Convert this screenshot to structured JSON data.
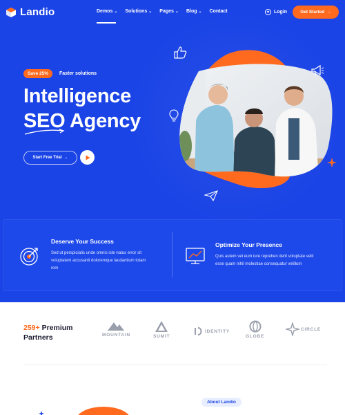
{
  "brand": {
    "name": "Landio"
  },
  "nav": {
    "items": [
      {
        "label": "Demos",
        "dropdown": true
      },
      {
        "label": "Solutions",
        "dropdown": true
      },
      {
        "label": "Pages",
        "dropdown": true
      },
      {
        "label": "Blog",
        "dropdown": true
      },
      {
        "label": "Contact",
        "dropdown": false
      }
    ],
    "login_label": "Login",
    "cta_label": "Get Started"
  },
  "hero": {
    "badge": "Save 25%",
    "badge_text": "Faster solutions",
    "headline_line1": "Intelligence",
    "headline_line2": "SEO Agency",
    "trial_label": "Start Free Trial"
  },
  "features": [
    {
      "title": "Deserve Your Success",
      "body_line1": "Sed ut perspiciatis unde omnis iste natus error sit",
      "body_line2": "voluptatem accusanti doloremque laudantium totam",
      "body_line3": "rem",
      "icon": "target-icon"
    },
    {
      "title": "Optimize Your Presence",
      "body_line1": "Quis autem vel eum iure reprehen derit voluptate velit",
      "body_line2": "esse quam nihil molestiae consequatur velillum",
      "icon": "chart-growth-icon"
    }
  ],
  "partners": {
    "count": "259+",
    "title_rest": "Premium",
    "title_line2": "Partners",
    "logos": [
      {
        "name": "MOUNTAIN",
        "icon": "mountain-icon"
      },
      {
        "name": "SUMIT",
        "icon": "summit-icon"
      },
      {
        "name": "IDENTITY",
        "icon": "identity-icon"
      },
      {
        "name": "GLOBE",
        "icon": "globe-icon"
      },
      {
        "name": "CIRCLE",
        "icon": "circle-icon"
      }
    ]
  },
  "about": {
    "pill": "About Landio"
  },
  "colors": {
    "primary": "#1b44e6",
    "accent": "#ff6a1f",
    "text": "#1a1a2e",
    "muted": "#9a9fac"
  }
}
